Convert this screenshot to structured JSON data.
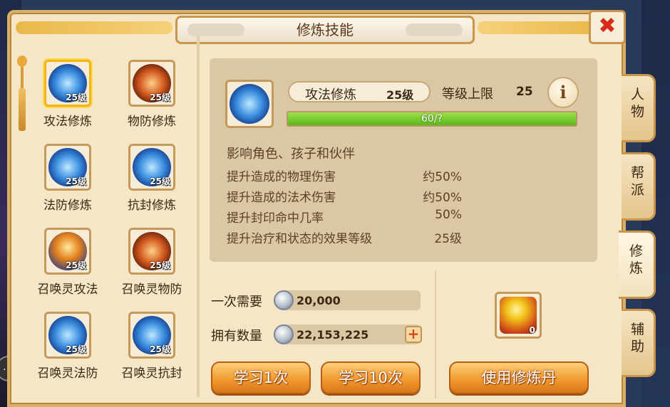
{
  "title": "修炼技能",
  "skills": [
    {
      "name": "攻法修炼",
      "level": "25级",
      "orb": "blue",
      "selected": true
    },
    {
      "name": "物防修炼",
      "level": "25级",
      "orb": "red",
      "selected": false
    },
    {
      "name": "法防修炼",
      "level": "25级",
      "orb": "blue",
      "selected": false
    },
    {
      "name": "抗封修炼",
      "level": "25级",
      "orb": "blue",
      "selected": false
    },
    {
      "name": "召唤灵攻法",
      "level": "25级",
      "orb": "fire",
      "selected": false
    },
    {
      "name": "召唤灵物防",
      "level": "25级",
      "orb": "red",
      "selected": false
    },
    {
      "name": "召唤灵法防",
      "level": "25级",
      "orb": "blue",
      "selected": false
    },
    {
      "name": "召唤灵抗封",
      "level": "25级",
      "orb": "blue",
      "selected": false
    }
  ],
  "detail": {
    "name": "攻法修炼",
    "level": "25级",
    "cap_label": "等级上限",
    "cap_value": "25",
    "info_label": "i",
    "progress_text": "60/?",
    "progress_fraction": 1.0,
    "affects": "影响角色、孩子和伙伴",
    "effects": [
      {
        "label": "提升造成的物理伤害",
        "value": "约50%"
      },
      {
        "label": "提升造成的法术伤害",
        "value": "约50%"
      },
      {
        "label": "提升封印命中几率",
        "value": "50%"
      },
      {
        "label": "提升治疗和状态的效果等级",
        "value": "25级"
      }
    ]
  },
  "cost": {
    "need_label": "一次需要",
    "need_value": "20,000",
    "own_label": "拥有数量",
    "own_value": "22,153,225",
    "plus": "+"
  },
  "buttons": {
    "learn1": "学习1次",
    "learn10": "学习10次",
    "use_item": "使用修炼丹"
  },
  "item": {
    "count": "0"
  },
  "close": "✖",
  "side_tabs": [
    {
      "label": "人物",
      "active": false
    },
    {
      "label": "帮派",
      "active": false
    },
    {
      "label": "修炼",
      "active": true
    },
    {
      "label": "辅助",
      "active": false
    }
  ],
  "bg_badge": "…"
}
